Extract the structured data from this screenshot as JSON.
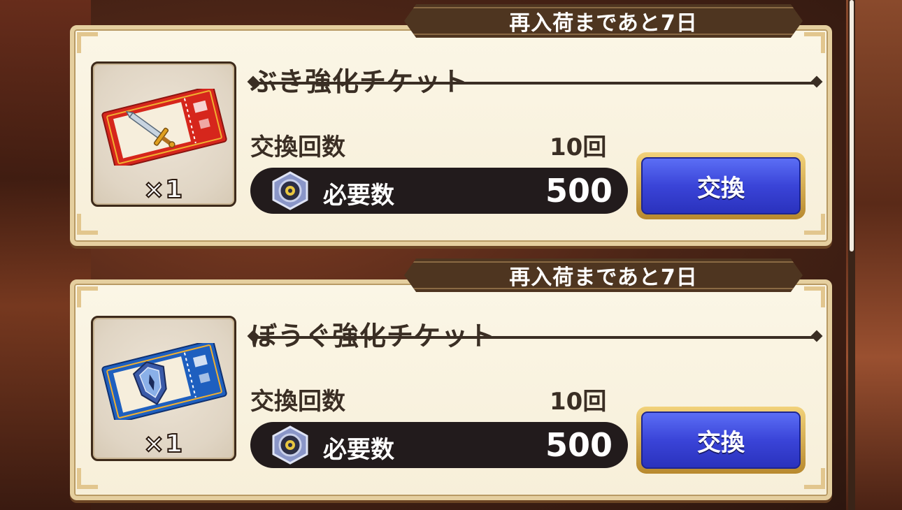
{
  "shop": {
    "items": [
      {
        "restock": "再入荷まであと7日",
        "name": "ぶき強化チケット",
        "quantity": "×1",
        "count_label": "交換回数",
        "count_value": "10回",
        "cost_label": "必要数",
        "cost_value": "500",
        "button_label": "交換",
        "ticket_icon": "sword-ticket-icon",
        "ticket_color": "#d6261c"
      },
      {
        "restock": "再入荷まであと7日",
        "name": "ぼうぐ強化チケット",
        "quantity": "×1",
        "count_label": "交換回数",
        "count_value": "10回",
        "cost_label": "必要数",
        "cost_value": "500",
        "button_label": "交換",
        "ticket_icon": "shield-ticket-icon",
        "ticket_color": "#1e5fbf"
      }
    ]
  },
  "colors": {
    "button_blue": "#3a44d8",
    "banner_brown": "#4e3520",
    "card_cream": "#fbf6e6"
  }
}
